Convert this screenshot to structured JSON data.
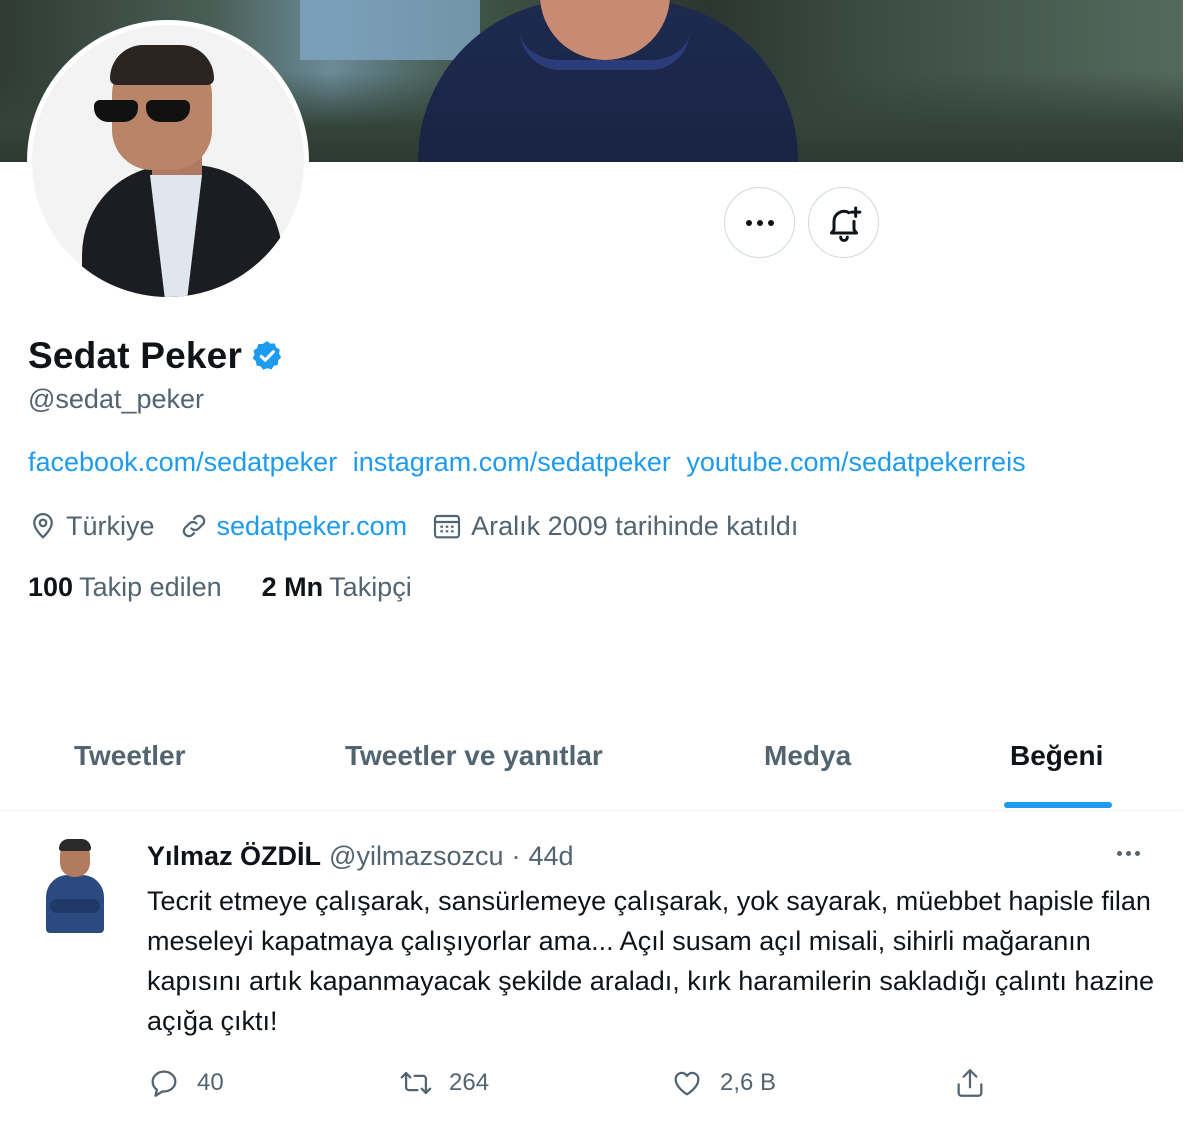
{
  "profile": {
    "name": "Sedat Peker",
    "handle": "@sedat_peker",
    "bio_links": [
      "facebook.com/sedatpeker",
      "instagram.com/sedatpeker",
      "youtube.com/sedatpekerreis"
    ],
    "location": "Türkiye",
    "website": "sedatpeker.com",
    "joined": "Aralık 2009 tarihinde katıldı",
    "following_count": "100",
    "following_label": "Takip edilen",
    "followers_count": "2 Mn",
    "followers_label": "Takipçi"
  },
  "icons": {
    "more": "more-horizontal-icon",
    "bell": "bell-plus-icon",
    "verified": "verified-badge-icon",
    "location": "location-pin-icon",
    "link": "link-icon",
    "calendar": "calendar-icon",
    "reply": "reply-icon",
    "retweet": "retweet-icon",
    "like": "heart-icon",
    "share": "share-icon"
  },
  "tabs": [
    {
      "label": "Tweetler"
    },
    {
      "label": "Tweetler ve yanıtlar"
    },
    {
      "label": "Medya"
    },
    {
      "label": "Beğeni"
    }
  ],
  "active_tab": "Beğeni",
  "tweet": {
    "author_name": "Yılmaz ÖZDİL",
    "author_handle": "@yilmazsozcu",
    "separator": "·",
    "time": "44d",
    "text": "Tecrit etmeye çalışarak, sansürlemeye çalışarak, yok sayarak, müebbet hapisle filan meseleyi kapatmaya çalışıyorlar ama... Açıl susam açıl misali, sihirli mağaranın kapısını artık kapanmayacak şekilde araladı, kırk haramilerin sakladığı çalıntı hazine açığa çıktı!",
    "replies": "40",
    "retweets": "264",
    "likes": "2,6 B"
  },
  "colors": {
    "accent": "#1d9bf0",
    "text": "#0f1419",
    "muted": "#536471",
    "border": "#cfd9de"
  }
}
